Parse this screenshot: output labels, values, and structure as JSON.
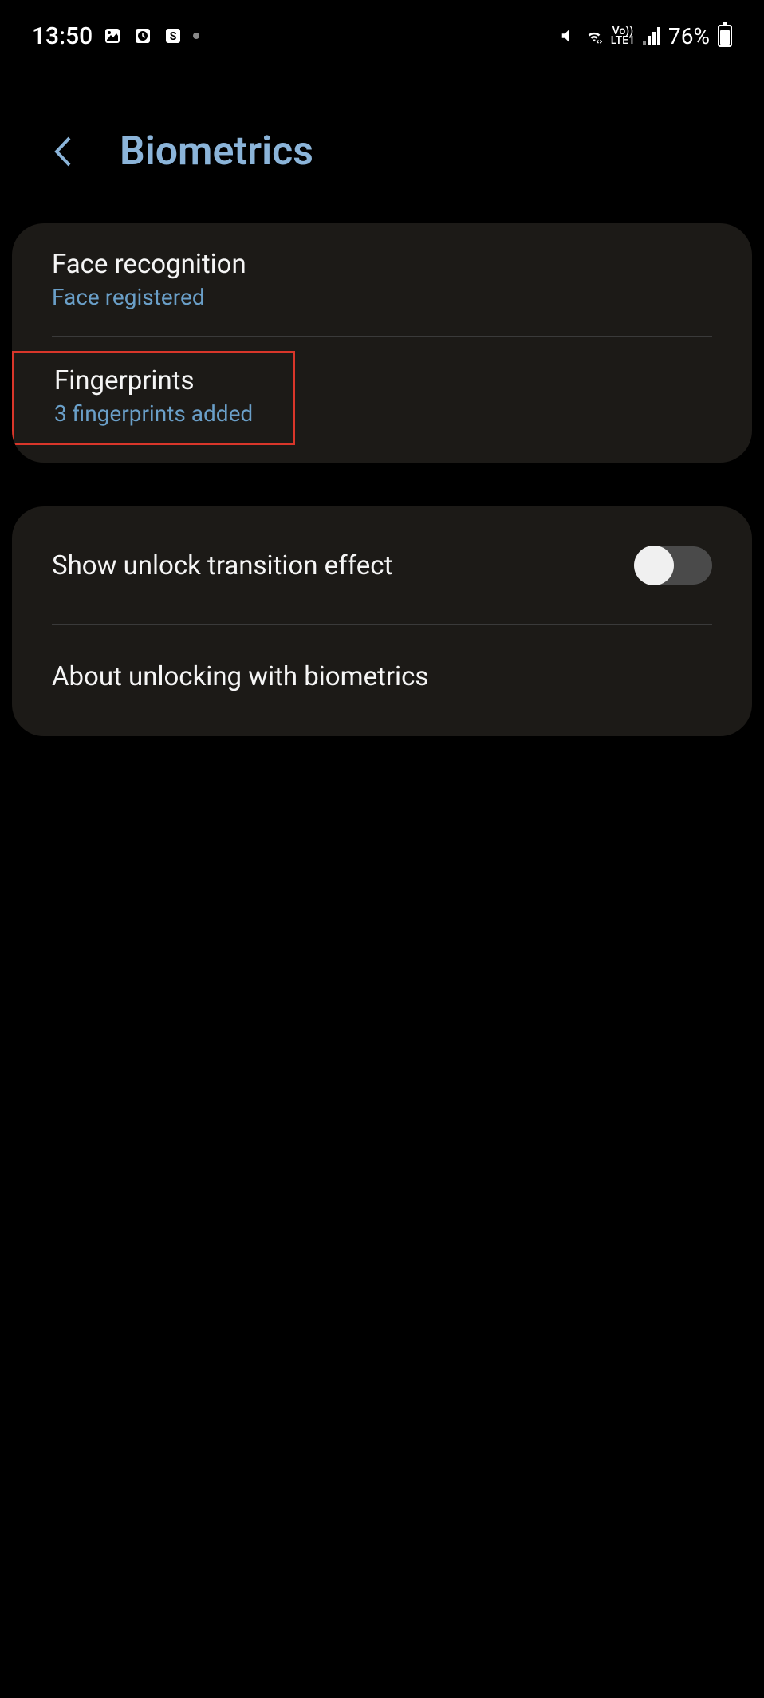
{
  "statusBar": {
    "time": "13:50",
    "battery": "76%",
    "lte": "LTE1",
    "vo": "Vo))"
  },
  "header": {
    "title": "Biometrics"
  },
  "biometrics": {
    "faceRecognition": {
      "title": "Face recognition",
      "status": "Face registered"
    },
    "fingerprints": {
      "title": "Fingerprints",
      "status": "3 fingerprints added"
    }
  },
  "settings": {
    "unlockTransition": {
      "title": "Show unlock transition effect",
      "enabled": false
    },
    "aboutBiometrics": {
      "title": "About unlocking with biometrics"
    }
  }
}
